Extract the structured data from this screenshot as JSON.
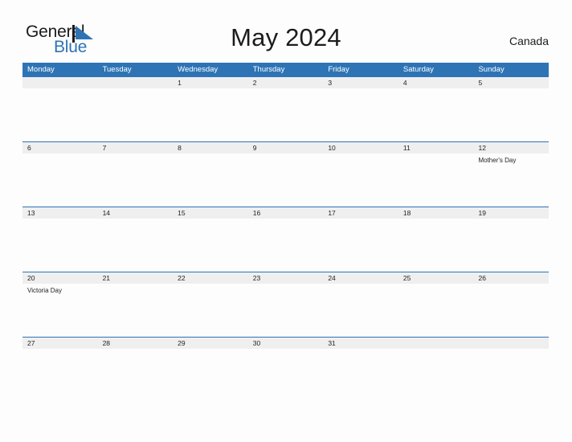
{
  "brand": {
    "name_part1": "General",
    "name_part2": "Blue",
    "flag_icon": "blue-triangle-flag-icon",
    "accent_color": "#2E74B5"
  },
  "header": {
    "title": "May 2024",
    "region": "Canada"
  },
  "colors": {
    "header_blue": "#2E74B5",
    "date_band_gray": "#EFEFEF",
    "page_background": "#FDFDFD",
    "text_dark": "#222222"
  },
  "calendar": {
    "month": "May",
    "year": "2024",
    "weekdays": [
      "Monday",
      "Tuesday",
      "Wednesday",
      "Thursday",
      "Friday",
      "Saturday",
      "Sunday"
    ],
    "weeks": [
      {
        "days": [
          {
            "date": "",
            "event": ""
          },
          {
            "date": "",
            "event": ""
          },
          {
            "date": "1",
            "event": ""
          },
          {
            "date": "2",
            "event": ""
          },
          {
            "date": "3",
            "event": ""
          },
          {
            "date": "4",
            "event": ""
          },
          {
            "date": "5",
            "event": ""
          }
        ]
      },
      {
        "days": [
          {
            "date": "6",
            "event": ""
          },
          {
            "date": "7",
            "event": ""
          },
          {
            "date": "8",
            "event": ""
          },
          {
            "date": "9",
            "event": ""
          },
          {
            "date": "10",
            "event": ""
          },
          {
            "date": "11",
            "event": ""
          },
          {
            "date": "12",
            "event": "Mother's Day"
          }
        ]
      },
      {
        "days": [
          {
            "date": "13",
            "event": ""
          },
          {
            "date": "14",
            "event": ""
          },
          {
            "date": "15",
            "event": ""
          },
          {
            "date": "16",
            "event": ""
          },
          {
            "date": "17",
            "event": ""
          },
          {
            "date": "18",
            "event": ""
          },
          {
            "date": "19",
            "event": ""
          }
        ]
      },
      {
        "days": [
          {
            "date": "20",
            "event": "Victoria Day"
          },
          {
            "date": "21",
            "event": ""
          },
          {
            "date": "22",
            "event": ""
          },
          {
            "date": "23",
            "event": ""
          },
          {
            "date": "24",
            "event": ""
          },
          {
            "date": "25",
            "event": ""
          },
          {
            "date": "26",
            "event": ""
          }
        ]
      },
      {
        "days": [
          {
            "date": "27",
            "event": ""
          },
          {
            "date": "28",
            "event": ""
          },
          {
            "date": "29",
            "event": ""
          },
          {
            "date": "30",
            "event": ""
          },
          {
            "date": "31",
            "event": ""
          },
          {
            "date": "",
            "event": ""
          },
          {
            "date": "",
            "event": ""
          }
        ]
      }
    ]
  }
}
